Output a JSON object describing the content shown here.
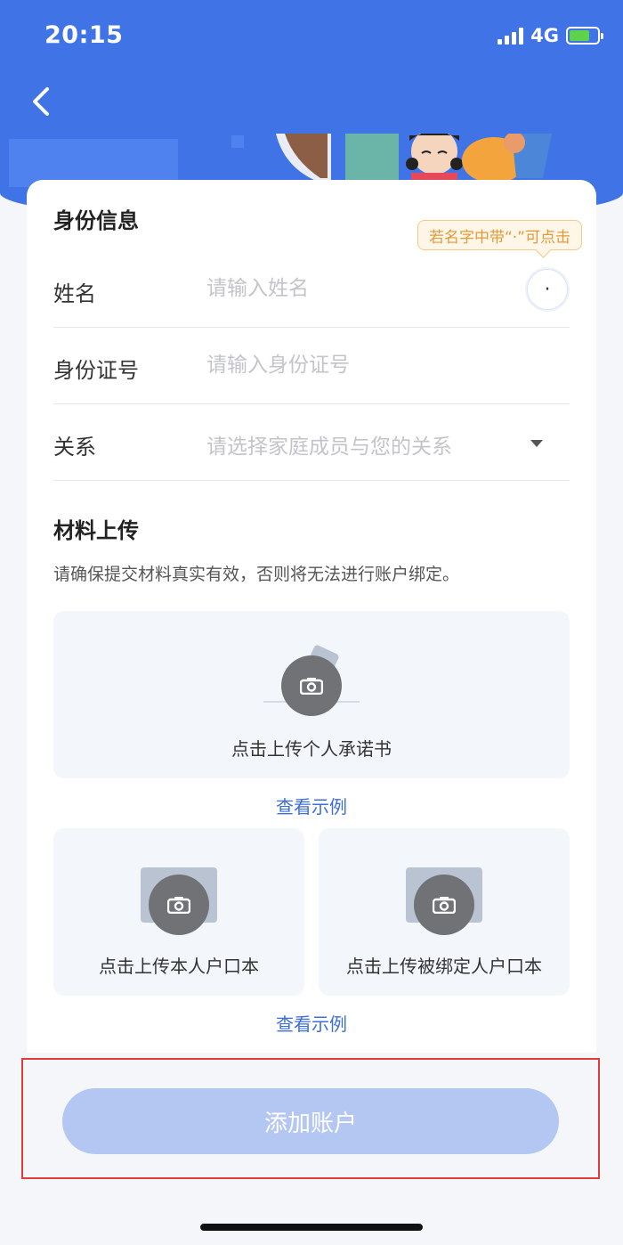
{
  "status_bar": {
    "time": "20:15",
    "network": "4G"
  },
  "nav": {
    "back_icon": "chevron-left-icon"
  },
  "identity": {
    "title": "身份信息",
    "tooltip": "若名字中带“·”可点击",
    "dot_char": "·",
    "fields": {
      "name": {
        "label": "姓名",
        "placeholder": "请输入姓名"
      },
      "id_number": {
        "label": "身份证号",
        "placeholder": "请输入身份证号"
      },
      "relation": {
        "label": "关系",
        "placeholder": "请选择家庭成员与您的关系"
      }
    }
  },
  "materials": {
    "title": "材料上传",
    "hint": "请确保提交材料真实有效，否则将无法进行账户绑定。",
    "commitment_upload": "点击上传个人承诺书",
    "view_example_1": "查看示例",
    "household_own_upload": "点击上传本人户口本",
    "household_bound_upload": "点击上传被绑定人户口本",
    "view_example_2": "查看示例"
  },
  "submit": {
    "label": "添加账户"
  },
  "colors": {
    "header_blue": "#3f73e6",
    "link_blue": "#3d6fd8",
    "button_disabled": "#b4c7f3",
    "tooltip_orange": "#e19a3a",
    "highlight_red": "#e23b3b"
  }
}
